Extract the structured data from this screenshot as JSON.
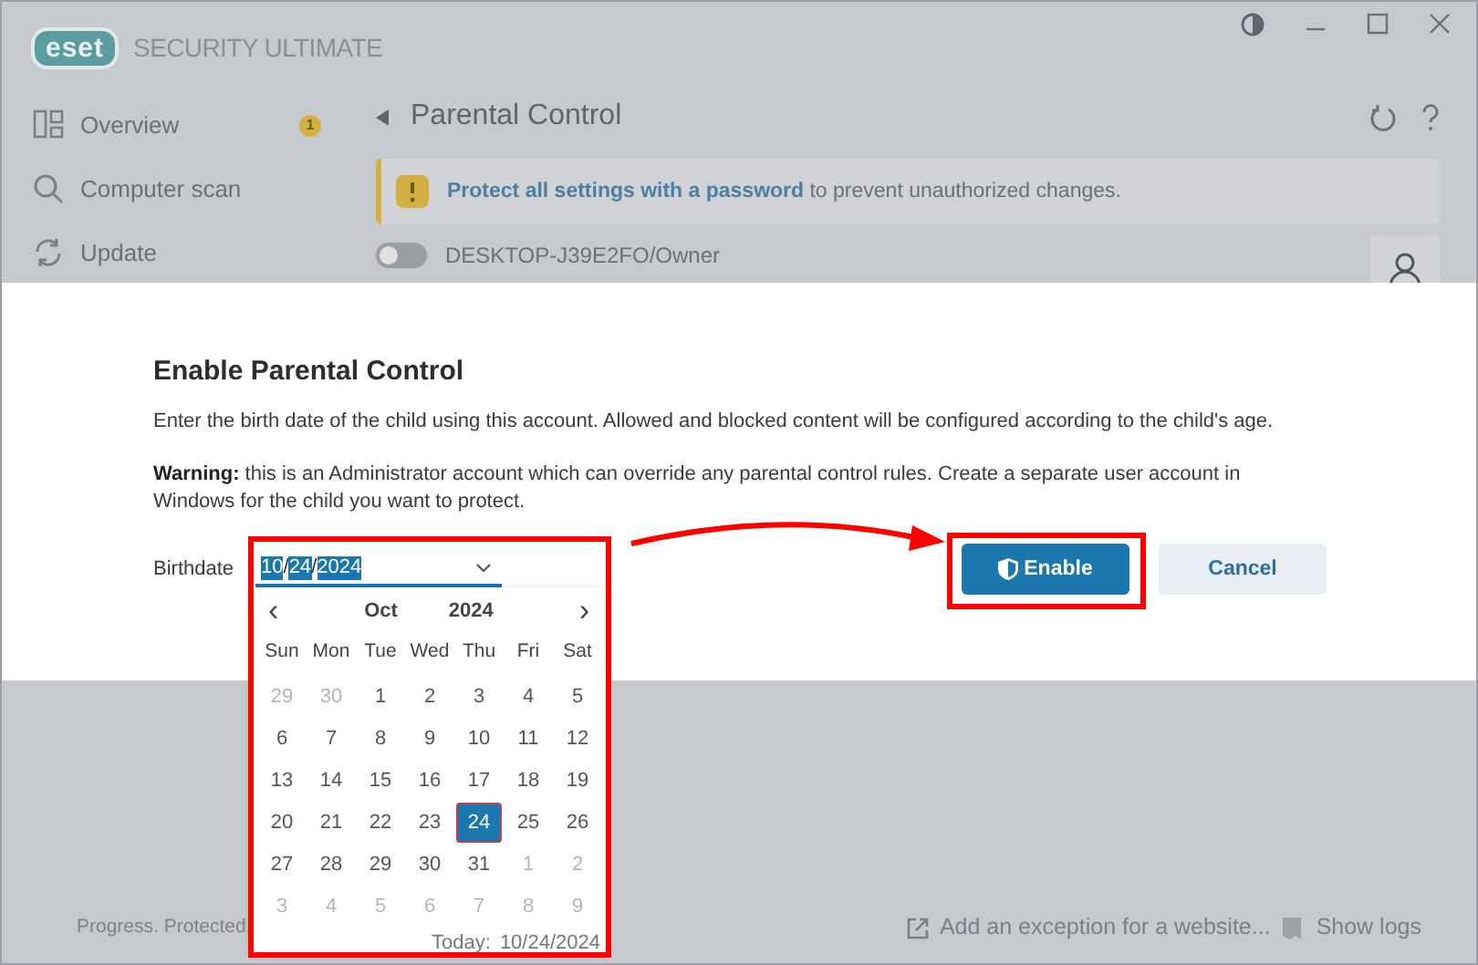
{
  "window": {
    "logo": "eset",
    "product": "SECURITY ULTIMATE"
  },
  "sidebar": {
    "items": [
      {
        "label": "Overview",
        "badge": "1"
      },
      {
        "label": "Computer scan"
      },
      {
        "label": "Update"
      }
    ]
  },
  "page": {
    "title": "Parental Control",
    "banner": {
      "link": "Protect all settings with a password",
      "text": "to prevent unauthorized changes."
    },
    "accounts": [
      {
        "name": "DESKTOP-J39E2FO/Owner",
        "enabled": false
      }
    ]
  },
  "footer": {
    "status": "Progress. Protected.",
    "links": [
      {
        "label": "Add an exception for a website..."
      },
      {
        "label": "Show logs"
      }
    ]
  },
  "dialog": {
    "title": "Enable Parental Control",
    "description": "Enter the birth date of the child using this account. Allowed and blocked content will be configured according to the child's age.",
    "warning": "**Warning:** this is an Administrator account which can override any parental control rules. Create a separate user account in Windows for the child you want to protect.",
    "birthdate_label": "Birthdate",
    "date_segments": [
      {
        "text": "10",
        "selected": true
      },
      {
        "text": "/",
        "selected": false
      },
      {
        "text": "24",
        "selected": true
      },
      {
        "text": "/",
        "selected": false
      },
      {
        "text": "2024",
        "selected": true
      }
    ],
    "buttons": [
      {
        "label": "Enable",
        "kind": "primary"
      },
      {
        "label": "Cancel",
        "kind": "secondary"
      }
    ]
  },
  "calendar": {
    "prev": "‹",
    "next": "›",
    "month": "Oct",
    "year": "2024",
    "weekdays": [
      "Sun",
      "Mon",
      "Tue",
      "Wed",
      "Thu",
      "Fri",
      "Sat"
    ],
    "weeks": [
      [
        {
          "day": "29",
          "in_month": false,
          "selected": false
        },
        {
          "day": "30",
          "in_month": false,
          "selected": false
        },
        {
          "day": "1",
          "in_month": true,
          "selected": false
        },
        {
          "day": "2",
          "in_month": true,
          "selected": false
        },
        {
          "day": "3",
          "in_month": true,
          "selected": false
        },
        {
          "day": "4",
          "in_month": true,
          "selected": false
        },
        {
          "day": "5",
          "in_month": true,
          "selected": false
        }
      ],
      [
        {
          "day": "6",
          "in_month": true,
          "selected": false
        },
        {
          "day": "7",
          "in_month": true,
          "selected": false
        },
        {
          "day": "8",
          "in_month": true,
          "selected": false
        },
        {
          "day": "9",
          "in_month": true,
          "selected": false
        },
        {
          "day": "10",
          "in_month": true,
          "selected": false
        },
        {
          "day": "11",
          "in_month": true,
          "selected": false
        },
        {
          "day": "12",
          "in_month": true,
          "selected": false
        }
      ],
      [
        {
          "day": "13",
          "in_month": true,
          "selected": false
        },
        {
          "day": "14",
          "in_month": true,
          "selected": false
        },
        {
          "day": "15",
          "in_month": true,
          "selected": false
        },
        {
          "day": "16",
          "in_month": true,
          "selected": false
        },
        {
          "day": "17",
          "in_month": true,
          "selected": false
        },
        {
          "day": "18",
          "in_month": true,
          "selected": false
        },
        {
          "day": "19",
          "in_month": true,
          "selected": false
        }
      ],
      [
        {
          "day": "20",
          "in_month": true,
          "selected": false
        },
        {
          "day": "21",
          "in_month": true,
          "selected": false
        },
        {
          "day": "22",
          "in_month": true,
          "selected": false
        },
        {
          "day": "23",
          "in_month": true,
          "selected": false
        },
        {
          "day": "24",
          "in_month": true,
          "selected": true
        },
        {
          "day": "25",
          "in_month": true,
          "selected": false
        },
        {
          "day": "26",
          "in_month": true,
          "selected": false
        }
      ],
      [
        {
          "day": "27",
          "in_month": true,
          "selected": false
        },
        {
          "day": "28",
          "in_month": true,
          "selected": false
        },
        {
          "day": "29",
          "in_month": true,
          "selected": false
        },
        {
          "day": "30",
          "in_month": true,
          "selected": false
        },
        {
          "day": "31",
          "in_month": true,
          "selected": false
        },
        {
          "day": "1",
          "in_month": false,
          "selected": false
        },
        {
          "day": "2",
          "in_month": false,
          "selected": false
        }
      ],
      [
        {
          "day": "3",
          "in_month": false,
          "selected": false
        },
        {
          "day": "4",
          "in_month": false,
          "selected": false
        },
        {
          "day": "5",
          "in_month": false,
          "selected": false
        },
        {
          "day": "6",
          "in_month": false,
          "selected": false
        },
        {
          "day": "7",
          "in_month": false,
          "selected": false
        },
        {
          "day": "8",
          "in_month": false,
          "selected": false
        },
        {
          "day": "9",
          "in_month": false,
          "selected": false
        }
      ]
    ],
    "today_label": "Today:",
    "today_value": "10/24/2024"
  },
  "callouts": {
    "highlight_date_picker": true,
    "highlight_enable": true,
    "arrow": true
  }
}
